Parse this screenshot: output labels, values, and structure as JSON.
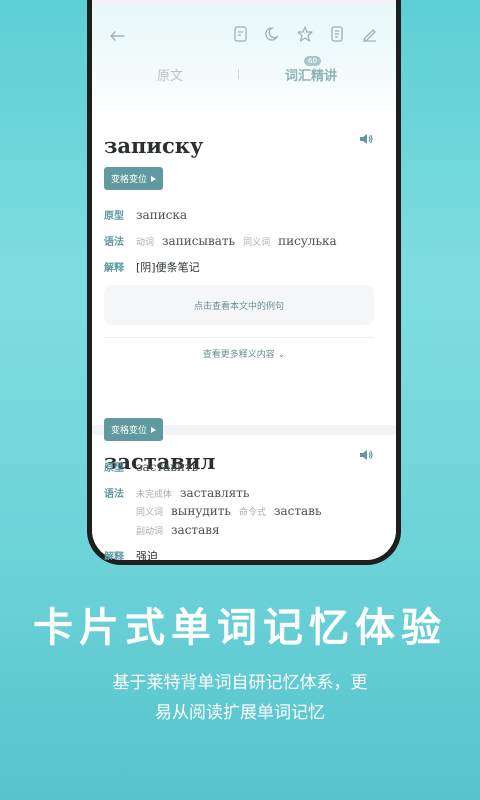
{
  "header": {
    "tabs": [
      {
        "label": "原文"
      },
      {
        "label": "词汇精讲",
        "badge": "60"
      }
    ]
  },
  "cards": [
    {
      "word": "записку",
      "conj_button": "变格变位",
      "rows": [
        {
          "label": "原型",
          "items": [
            {
              "text": "записка",
              "kind": "ru"
            }
          ]
        },
        {
          "label": "语法",
          "items": [
            {
              "text": "动词",
              "kind": "tag"
            },
            {
              "text": "записывать",
              "kind": "ru"
            },
            {
              "text": "同义词",
              "kind": "tag"
            },
            {
              "text": "писулька",
              "kind": "ru"
            }
          ]
        },
        {
          "label": "解释",
          "items": [
            {
              "text": "[阴]便条笔记",
              "kind": "val"
            }
          ]
        }
      ],
      "example_button": "点击查看本文中的例句",
      "more_label": "查看更多释义内容"
    },
    {
      "word": "заставил",
      "conj_button": "变格变位",
      "rows": [
        {
          "label": "原型",
          "items": [
            {
              "text": "заставить",
              "kind": "ru"
            }
          ]
        },
        {
          "label": "语法",
          "items": [
            {
              "text": "未完成体",
              "kind": "tag"
            },
            {
              "text": "заставлять",
              "kind": "ru"
            }
          ]
        },
        {
          "label": "",
          "items": [
            {
              "text": "同义词",
              "kind": "tag"
            },
            {
              "text": "вынудить",
              "kind": "ru"
            },
            {
              "text": "命令式",
              "kind": "tag"
            },
            {
              "text": "заставь",
              "kind": "ru"
            }
          ]
        },
        {
          "label": "",
          "items": [
            {
              "text": "副动词",
              "kind": "tag"
            },
            {
              "text": "заставя",
              "kind": "ru"
            }
          ]
        },
        {
          "label": "解释",
          "items": [
            {
              "text": "强迫",
              "kind": "val"
            }
          ]
        }
      ]
    }
  ],
  "promo": {
    "headline": "卡片式单词记忆体验",
    "subline_1": "基于莱特背单词自研记忆体系，更",
    "subline_2": "易从阅读扩展单词记忆"
  },
  "colors": {
    "accent": "#5f9aa0",
    "background_top": "#5ccfd4",
    "background_bottom": "#57c3cc"
  }
}
